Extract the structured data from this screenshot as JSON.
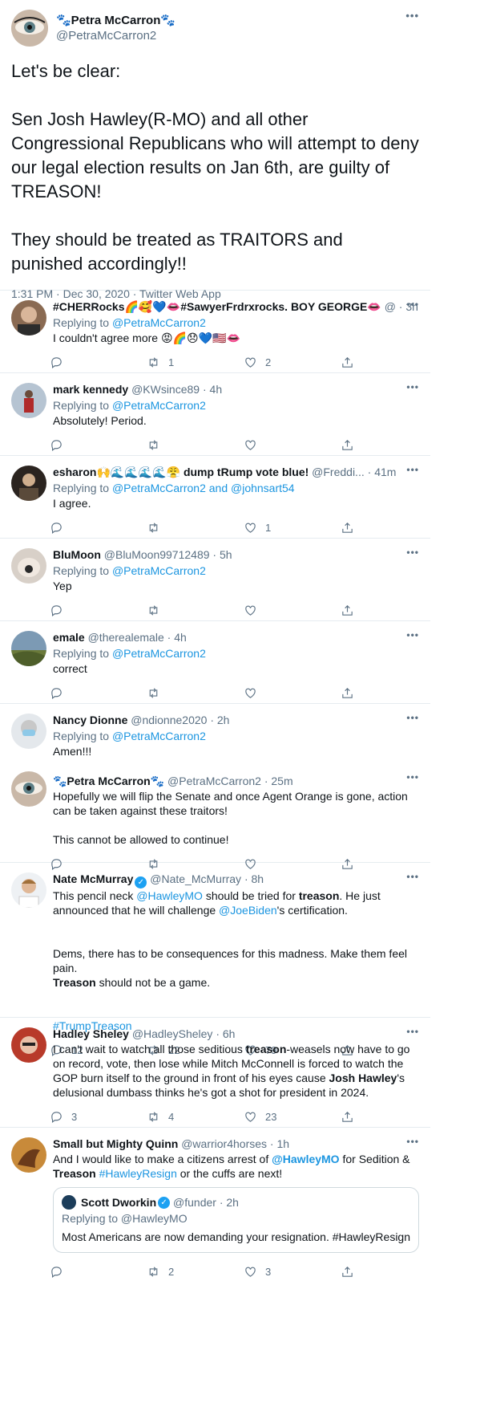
{
  "main_tweet": {
    "name": "🐾Petra McCarron🐾",
    "handle": "@PetraMcCarron2",
    "text": "Let's be clear:\n\nSen Josh Hawley(R-MO) and all other Congressional Republicans who will attempt to deny our legal election results on Jan 6th, are guilty of TREASON!\n\nThey should be treated as TRAITORS and punished accordingly!!",
    "meta": "1:31 PM · Dec 30, 2020 · Twitter Web App",
    "more": "•••"
  },
  "labels": {
    "replying_to": "Replying to",
    "and": "and"
  },
  "replies": [
    {
      "name": "#CHERRocks🌈🥰💙👄#SawyerFrdrxrocks. BOY GEORGE👄",
      "handle": "@",
      "time": "3h",
      "replying": "@PetraMcCarron2",
      "text": "I couldn't agree more 😡🌈😞💙🇺🇸👄",
      "counts": {
        "reply": "",
        "retweet": "1",
        "like": "2"
      }
    },
    {
      "name": "mark kennedy",
      "handle": "@KWsince89",
      "time": "4h",
      "replying": "@PetraMcCarron2",
      "text": "Absolutely! Period.",
      "counts": {
        "reply": "",
        "retweet": "",
        "like": ""
      }
    },
    {
      "name": "esharon🙌🌊🌊🌊🌊😤 dump tRump vote blue!",
      "handle": "@Freddi...",
      "time": "41m",
      "replying": "@PetraMcCarron2",
      "replying2": "@johnsart54",
      "text": "I agree.",
      "counts": {
        "reply": "",
        "retweet": "",
        "like": "1"
      }
    },
    {
      "name": "BluMoon",
      "handle": "@BluMoon99712489",
      "time": "5h",
      "replying": "@PetraMcCarron2",
      "text": "Yep",
      "counts": {
        "reply": "",
        "retweet": "",
        "like": ""
      }
    },
    {
      "name": "emale",
      "handle": "@therealemale",
      "time": "4h",
      "replying": "@PetraMcCarron2",
      "text": "correct",
      "counts": {
        "reply": "",
        "retweet": "",
        "like": ""
      }
    },
    {
      "name": "Nancy Dionne",
      "handle": "@ndionne2020",
      "time": "2h",
      "replying": "@PetraMcCarron2",
      "text": "Amen!!!",
      "counts": {
        "reply": "",
        "retweet": "",
        "like": ""
      }
    },
    {
      "name": "🐾Petra McCarron🐾",
      "handle": "@PetraMcCarron2",
      "time": "25m",
      "text": "Hopefully we will flip the Senate and once Agent Orange is gone, action can be taken against these traitors!\n\nThis cannot be allowed to continue!",
      "counts": {
        "reply": "",
        "retweet": "",
        "like": ""
      }
    },
    {
      "name": "Nate McMurray",
      "handle": "@Nate_McMurray",
      "time": "8h",
      "text_parts": {
        "a": "This pencil neck ",
        "b": "@HawleyMO",
        "c": " should be tried for ",
        "d": "treason",
        "e": ". He just announced that he will challenge ",
        "f": "@JoeBiden",
        "g": "'s certification.",
        "h": "Dems, there has to be consequences for this madness. Make them feel pain.",
        "i": "Treason",
        "j": " should not be a game.",
        "k": "#TrumpTreason"
      },
      "counts": {
        "reply": "12",
        "retweet": "22",
        "like": "79"
      }
    },
    {
      "name": "Hadley Sheley",
      "handle": "@HadleySheley",
      "time": "6h",
      "text_parts": {
        "a": "I can't wait to watch all those seditious ",
        "b": "treason",
        "c": "-weasels now have to go on record, vote, then lose while Mitch McConnell is forced to watch the GOP burn itself to the ground in front of his eyes cause ",
        "d": "Josh Hawley",
        "e": "'s delusional dumbass thinks he's got a shot for president in 2024."
      },
      "counts": {
        "reply": "3",
        "retweet": "4",
        "like": "23"
      }
    },
    {
      "name": "Small but Mighty Quinn",
      "handle": "@warrior4horses",
      "time": "1h",
      "text_parts": {
        "a": "And I would like to make a citizens arrest of ",
        "b": "@HawleyMO",
        "c": " for Sedition & ",
        "d": "Treason",
        "e": "#HawleyResign",
        "f": " or the cuffs are next!"
      },
      "quote": {
        "name": "Scott Dworkin",
        "handle": "@funder",
        "time": "2h",
        "replying": "Replying to @HawleyMO",
        "text": "Most Americans are now demanding your resignation. #HawleyResign"
      },
      "counts": {
        "reply": "",
        "retweet": "2",
        "like": "3"
      }
    }
  ],
  "colors": {
    "link": "#1b95e0",
    "secondary": "#5b7083",
    "border": "#e6ecf0"
  },
  "icons": [
    "reply-icon",
    "retweet-icon",
    "like-icon",
    "share-icon",
    "more-icon",
    "verified-icon"
  ]
}
